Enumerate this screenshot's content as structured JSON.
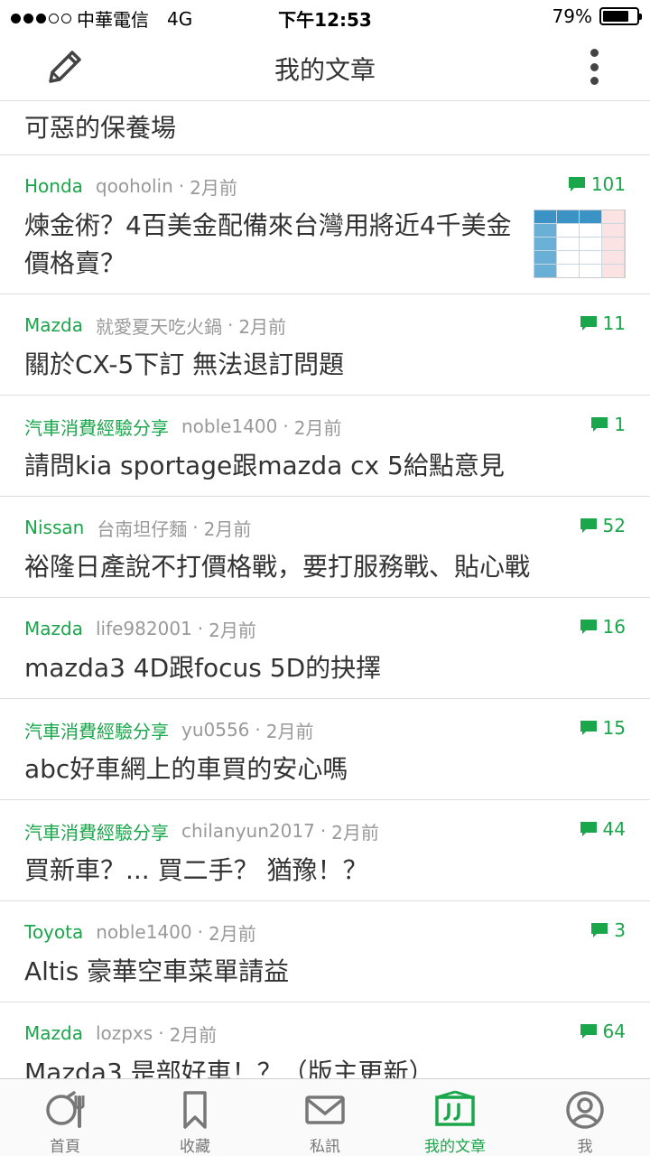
{
  "status_bar": {
    "carrier": "中華電信",
    "network": "4G",
    "time": "下午12:53",
    "battery": "79%",
    "battery_level": 0.79
  },
  "nav": {
    "title": "我的文章",
    "compose_icon": "pencil-icon",
    "more_icon": "more-vertical-icon"
  },
  "partial_post": {
    "title": "可惡的保養場"
  },
  "posts": [
    {
      "board": "Honda",
      "author": "qooholin",
      "time": "2月前",
      "comments": "101",
      "title": "煉金術？4百美金配備來台灣用將近4千美金價格賣？",
      "has_thumb": true
    },
    {
      "board": "Mazda",
      "author": "就愛夏天吃火鍋",
      "time": "2月前",
      "comments": "11",
      "title": "關於CX-5下訂 無法退訂問題"
    },
    {
      "board": "汽車消費經驗分享",
      "author": "noble1400",
      "time": "2月前",
      "comments": "1",
      "title": "請問kia sportage跟mazda cx 5給點意見"
    },
    {
      "board": "Nissan",
      "author": "台南坦仔麵",
      "time": "2月前",
      "comments": "52",
      "title": "裕隆日產說不打價格戰，要打服務戰、貼心戰"
    },
    {
      "board": "Mazda",
      "author": "life982001",
      "time": "2月前",
      "comments": "16",
      "title": "mazda3 4D跟focus  5D的抉擇"
    },
    {
      "board": "汽車消費經驗分享",
      "author": "yu0556",
      "time": "2月前",
      "comments": "15",
      "title": "abc好車網上的車買的安心嗎"
    },
    {
      "board": "汽車消費經驗分享",
      "author": "chilanyun2017",
      "time": "2月前",
      "comments": "44",
      "title": "買新車？... 買二手？    猶豫！？"
    },
    {
      "board": "Toyota",
      "author": "noble1400",
      "time": "2月前",
      "comments": "3",
      "title": "Altis 豪華空車菜單請益"
    },
    {
      "board": "Mazda",
      "author": "lozpxs",
      "time": "2月前",
      "comments": "64",
      "title": "Mazda3 是部好車！？（版主更新）"
    }
  ],
  "tabs": [
    {
      "label": "首頁",
      "icon": "home-icon"
    },
    {
      "label": "收藏",
      "icon": "bookmark-icon"
    },
    {
      "label": "私訊",
      "icon": "mail-icon"
    },
    {
      "label": "我的文章",
      "icon": "my-articles-icon",
      "active": true
    },
    {
      "label": "我",
      "icon": "profile-icon"
    }
  ],
  "colors": {
    "accent": "#1aa64a",
    "text": "#333333",
    "meta": "#999999",
    "divider": "#dcdcdc"
  }
}
